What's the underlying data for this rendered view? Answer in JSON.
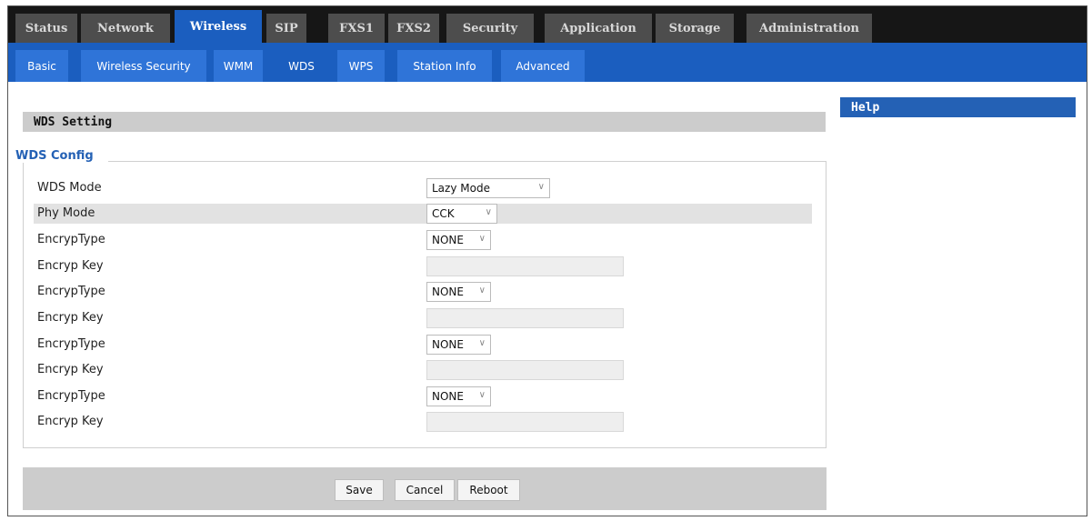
{
  "top_tabs": [
    "Status",
    "Network",
    "Wireless",
    "SIP",
    "FXS1",
    "FXS2",
    "Security",
    "Application",
    "Storage",
    "Administration"
  ],
  "active_top_tab": "Wireless",
  "sub_tabs": [
    "Basic",
    "Wireless Security",
    "WMM",
    "WDS",
    "WPS",
    "Station Info",
    "Advanced"
  ],
  "active_sub_tab": "WDS",
  "section_title": "WDS Setting",
  "help_title": "Help",
  "legend": "WDS Config",
  "fields": {
    "wds_mode": {
      "label": "WDS Mode",
      "value": "Lazy Mode"
    },
    "phy_mode": {
      "label": "Phy Mode",
      "value": "CCK"
    },
    "encryp_type_1": {
      "label": "EncrypType",
      "value": "NONE"
    },
    "encryp_key_1": {
      "label": "Encryp Key",
      "value": ""
    },
    "encryp_type_2": {
      "label": "EncrypType",
      "value": "NONE"
    },
    "encryp_key_2": {
      "label": "Encryp Key",
      "value": ""
    },
    "encryp_type_3": {
      "label": "EncrypType",
      "value": "NONE"
    },
    "encryp_key_3": {
      "label": "Encryp Key",
      "value": ""
    },
    "encryp_type_4": {
      "label": "EncrypType",
      "value": "NONE"
    },
    "encryp_key_4": {
      "label": "Encryp Key",
      "value": ""
    }
  },
  "buttons": {
    "save": "Save",
    "cancel": "Cancel",
    "reboot": "Reboot"
  },
  "colors": {
    "topbar": "#161616",
    "tab": "#4d4d4d",
    "accent": "#1b5ebf",
    "subtab": "#2f74d8",
    "section": "#cccccc",
    "legend_text": "#2461b5"
  }
}
